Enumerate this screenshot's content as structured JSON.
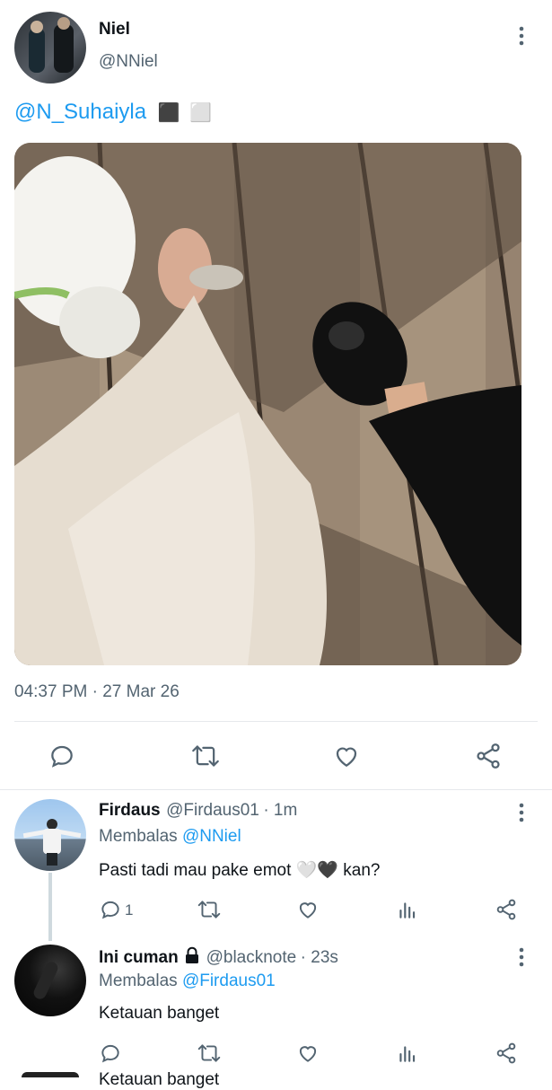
{
  "tweet": {
    "author_name": "Niel",
    "author_handle": "@NNiel",
    "mention": "@N_Suhaiyla",
    "emojis": [
      "⬛",
      "⬜"
    ],
    "timestamp": "04:37 PM · 27 Mar 26"
  },
  "replies": [
    {
      "name": "Firdaus",
      "handle": "@Firdaus01",
      "time": "· 1m",
      "replying_prefix": "Membalas",
      "replying_to": "@NNiel",
      "text": "Pasti tadi mau pake emot 🤍🖤 kan?",
      "reply_count": "1"
    },
    {
      "name": "Ini cuman",
      "locked": true,
      "handle": "@blacknote",
      "time": "· 23s",
      "replying_prefix": "Membalas",
      "replying_to": "@Firdaus01",
      "text": "Ketauan banget"
    }
  ],
  "cutoff_text": "Ketauan banget",
  "colors": {
    "accent": "#1d9bf0",
    "secondary": "#536471",
    "divider": "#e6e9ec"
  }
}
